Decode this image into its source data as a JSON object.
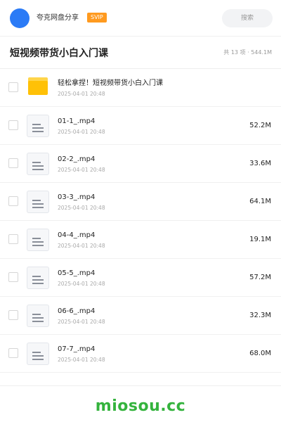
{
  "header": {
    "brand": "夸克网盘分享",
    "badge": "SVIP",
    "search_placeholder": "搜索",
    "avatar_color": "#2b7bf6",
    "badge_color": "#ff9a1f"
  },
  "folder": {
    "title": "短视频带货小白入门课",
    "summary": "共 13 项 · 544.1M"
  },
  "items": [
    {
      "name": "轻松拿捏！短视频带货小白入门课",
      "date": "2025-04-01 20:48",
      "size": "",
      "icon": "folder-icon"
    },
    {
      "name": "01-1_.mp4",
      "date": "2025-04-01 20:48",
      "size": "52.2M",
      "icon": "video-file-icon"
    },
    {
      "name": "02-2_.mp4",
      "date": "2025-04-01 20:48",
      "size": "33.6M",
      "icon": "video-file-icon"
    },
    {
      "name": "03-3_.mp4",
      "date": "2025-04-01 20:48",
      "size": "64.1M",
      "icon": "video-file-icon"
    },
    {
      "name": "04-4_.mp4",
      "date": "2025-04-01 20:48",
      "size": "19.1M",
      "icon": "video-file-icon"
    },
    {
      "name": "05-5_.mp4",
      "date": "2025-04-01 20:48",
      "size": "57.2M",
      "icon": "video-file-icon"
    },
    {
      "name": "06-6_.mp4",
      "date": "2025-04-01 20:48",
      "size": "32.3M",
      "icon": "video-file-icon"
    },
    {
      "name": "07-7_.mp4",
      "date": "2025-04-01 20:48",
      "size": "68.0M",
      "icon": "video-file-icon"
    }
  ],
  "watermark": {
    "text": "miosou.cc",
    "color": "#34b33d"
  }
}
